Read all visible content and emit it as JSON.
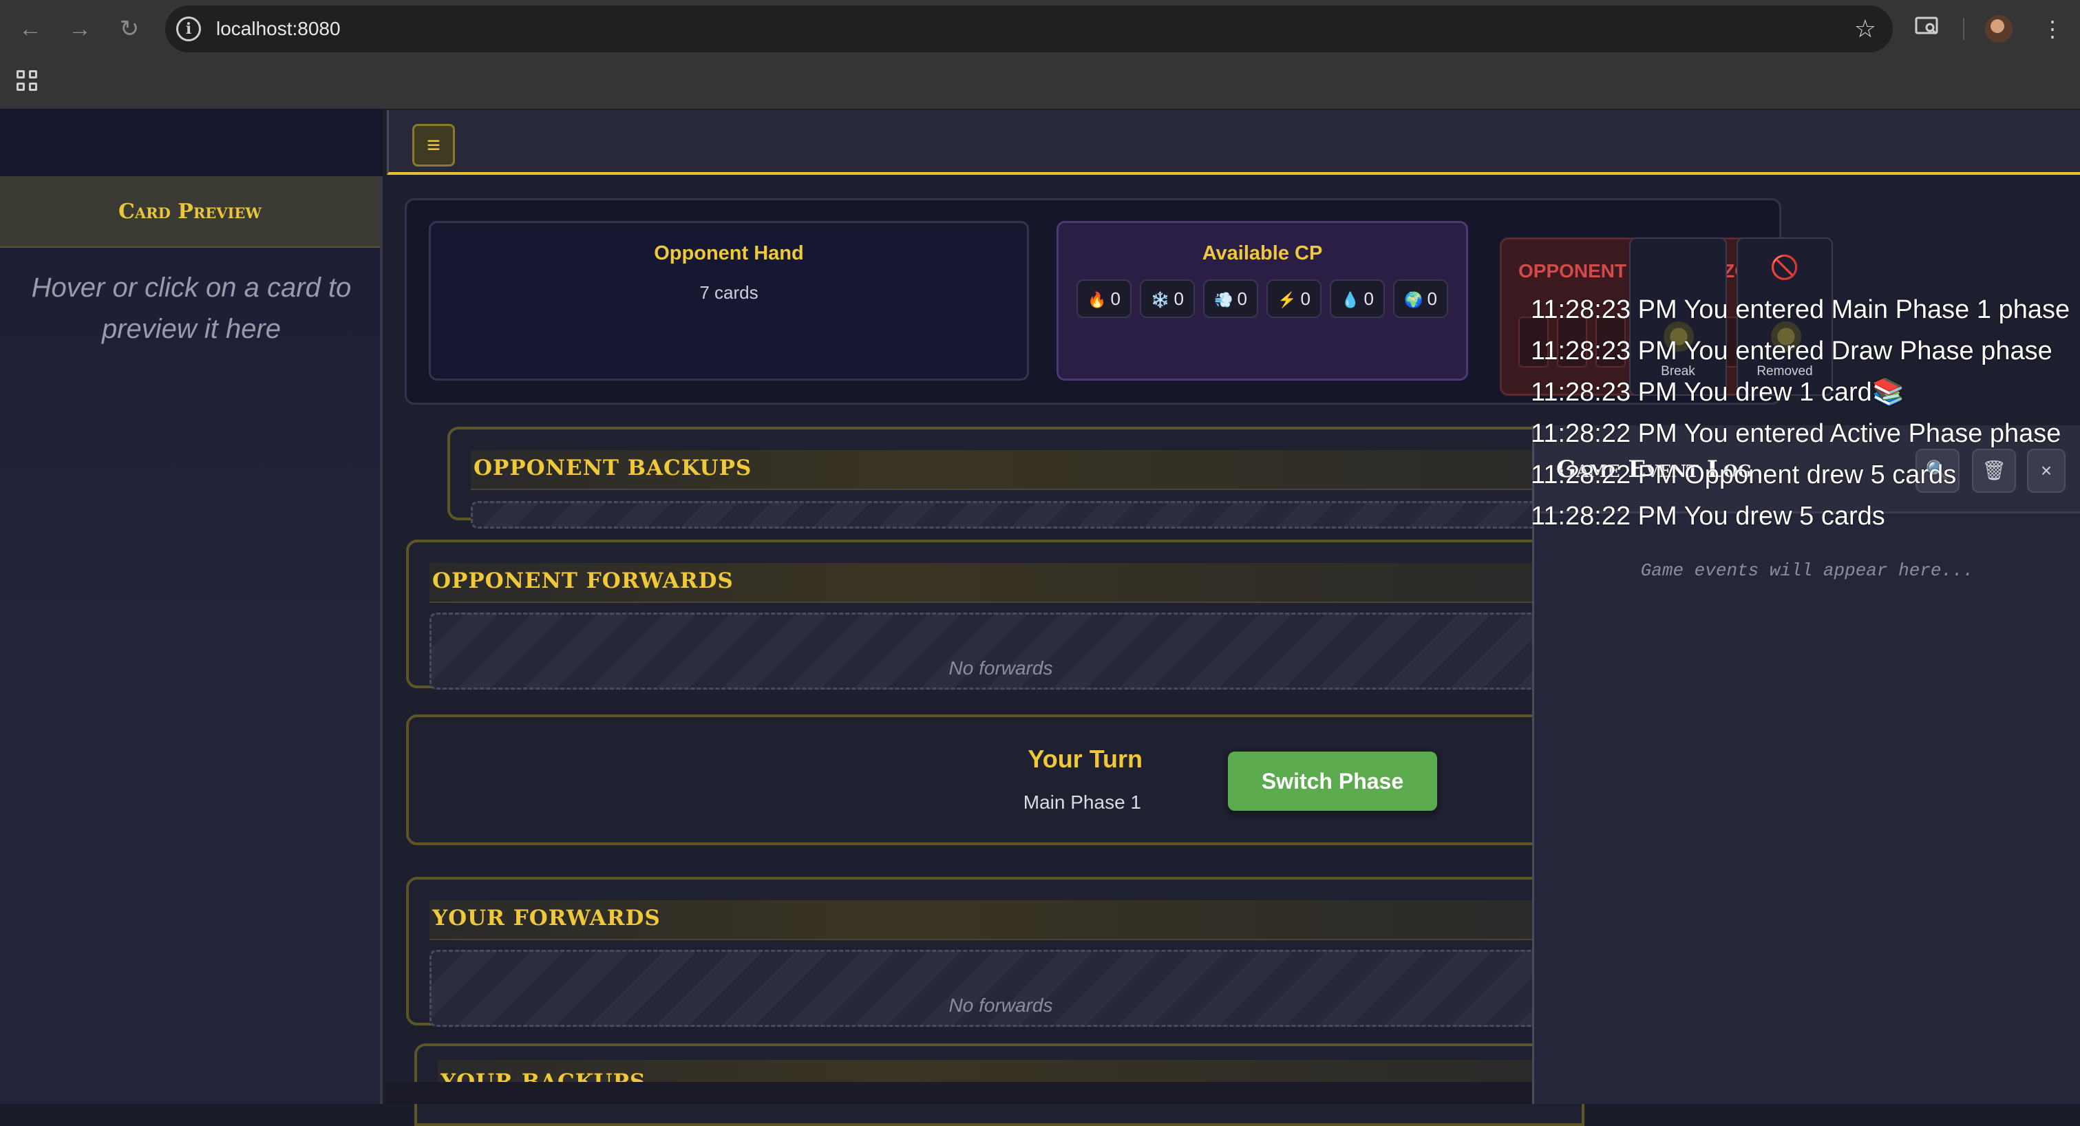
{
  "browser": {
    "url": "localhost:8080",
    "back_icon": "arrow-left-icon",
    "forward_icon": "arrow-right-icon",
    "reload_icon": "reload-icon",
    "info_glyph": "i",
    "star_glyph": "☆",
    "menu_glyph": "⋮"
  },
  "sidebar": {
    "title": "Card Preview",
    "hint": "Hover or click on a card to preview it here"
  },
  "header": {
    "menu_glyph": "≡"
  },
  "opponent_hand": {
    "title": "Opponent Hand",
    "count": "7 cards"
  },
  "cp": {
    "title": "Available CP",
    "items": [
      {
        "icon": "🔥",
        "value": "0"
      },
      {
        "icon": "❄️",
        "value": "0"
      },
      {
        "icon": "💨",
        "value": "0"
      },
      {
        "icon": "⚡",
        "value": "0"
      },
      {
        "icon": "💧",
        "value": "0"
      },
      {
        "icon": "🌍",
        "value": "0"
      }
    ]
  },
  "damage_zone": {
    "title": "OPPONENT DAMAGE ZONE"
  },
  "zones": {
    "break_label": "Break",
    "removed_label": "Removed",
    "removed_icon": "🚫"
  },
  "sections": {
    "opponent_backups": "OPPONENT BACKUPS",
    "opponent_forwards": "OPPONENT FORWARDS",
    "your_forwards": "YOUR FORWARDS",
    "your_backups": "YOUR BACKUPS",
    "no_forwards": "No forwards"
  },
  "turn": {
    "title": "Your Turn",
    "phase": "Main Phase 1",
    "switch_label": "Switch Phase"
  },
  "event_log": {
    "title": "Game Event Log",
    "empty_text": "Game events will appear here...",
    "search_icon": "🔍",
    "trash_icon": "🗑",
    "close_glyph": "×"
  },
  "overlay_lines": [
    "11:28:23 PM You entered Main Phase 1 phase",
    "11:28:23 PM You entered Draw Phase phase",
    "11:28:23 PM You drew 1 card📚",
    "11:28:22 PM You entered Active Phase phase",
    "11:28:22 PM Opponent drew 5 cards",
    "11:28:22 PM You drew 5 cards"
  ]
}
